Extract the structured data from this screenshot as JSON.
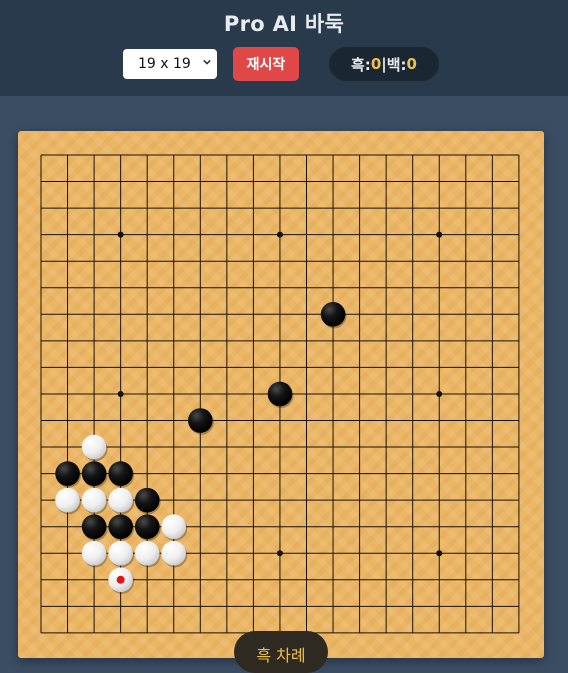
{
  "app": {
    "title": "Pro AI 바둑"
  },
  "controls": {
    "board_size": "19 x 19",
    "restart_label": "재시작",
    "score": {
      "black_label": "흑:",
      "black_count": "0",
      "separator": "|",
      "white_label": "백:",
      "white_count": "0"
    }
  },
  "board": {
    "size": 19,
    "hoshi": [
      [
        3,
        3
      ],
      [
        3,
        9
      ],
      [
        3,
        15
      ],
      [
        9,
        3
      ],
      [
        9,
        9
      ],
      [
        9,
        15
      ],
      [
        15,
        3
      ],
      [
        15,
        9
      ],
      [
        15,
        15
      ]
    ],
    "stones": [
      {
        "color": "black",
        "col": 11,
        "row": 6
      },
      {
        "color": "black",
        "col": 9,
        "row": 9
      },
      {
        "color": "black",
        "col": 6,
        "row": 10
      },
      {
        "color": "white",
        "col": 2,
        "row": 11
      },
      {
        "color": "black",
        "col": 1,
        "row": 12
      },
      {
        "color": "black",
        "col": 2,
        "row": 12
      },
      {
        "color": "black",
        "col": 3,
        "row": 12
      },
      {
        "color": "white",
        "col": 1,
        "row": 13
      },
      {
        "color": "white",
        "col": 2,
        "row": 13
      },
      {
        "color": "white",
        "col": 3,
        "row": 13
      },
      {
        "color": "black",
        "col": 4,
        "row": 13
      },
      {
        "color": "black",
        "col": 2,
        "row": 14
      },
      {
        "color": "black",
        "col": 3,
        "row": 14
      },
      {
        "color": "black",
        "col": 4,
        "row": 14
      },
      {
        "color": "white",
        "col": 5,
        "row": 14
      },
      {
        "color": "white",
        "col": 2,
        "row": 15
      },
      {
        "color": "white",
        "col": 3,
        "row": 15
      },
      {
        "color": "white",
        "col": 4,
        "row": 15
      },
      {
        "color": "white",
        "col": 5,
        "row": 15
      },
      {
        "color": "white",
        "col": 3,
        "row": 16,
        "last_move": true
      }
    ]
  },
  "status": {
    "turn_label": "흑 차례"
  },
  "colors": {
    "board": "#ecb765",
    "header": "#2a3a4d",
    "restart": "#e04848",
    "accent": "#f0c040",
    "last_move_marker": "#e01515"
  }
}
